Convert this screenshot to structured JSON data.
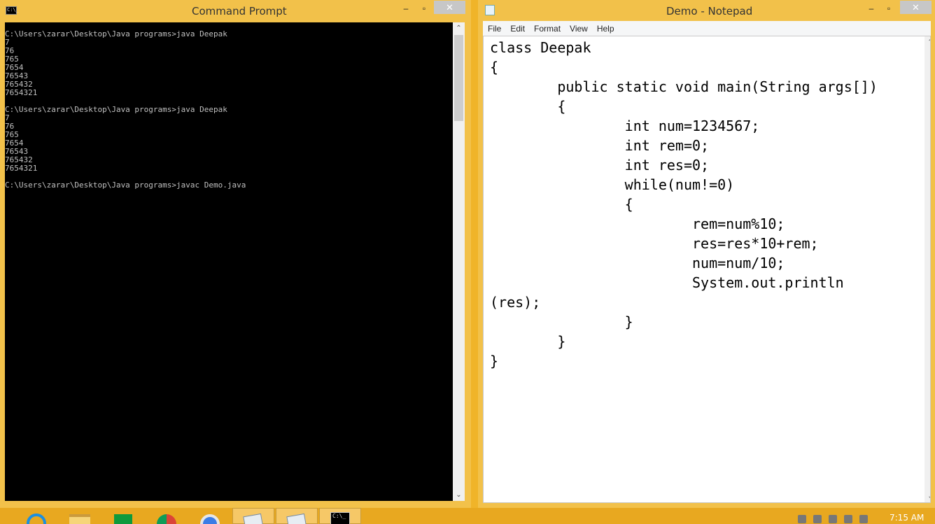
{
  "cmd": {
    "title": "Command Prompt",
    "icon_label": "C:\\_",
    "buttons": {
      "minimize": "–",
      "maximize": "▫",
      "close": "✕"
    },
    "output": "C:\\Users\\zarar\\Desktop\\Java programs>java Deepak\n7\n76\n765\n7654\n76543\n765432\n7654321\n\nC:\\Users\\zarar\\Desktop\\Java programs>java Deepak\n7\n76\n765\n7654\n76543\n765432\n7654321\n\nC:\\Users\\zarar\\Desktop\\Java programs>javac Demo.java"
  },
  "notepad": {
    "title": "Demo - Notepad",
    "buttons": {
      "minimize": "–",
      "maximize": "▫",
      "close": "✕"
    },
    "menu": [
      "File",
      "Edit",
      "Format",
      "View",
      "Help"
    ],
    "content": "class Deepak\n{\n\tpublic static void main(String args[])\n\t{\n\t\tint num=1234567;\n\t\tint rem=0;\n\t\tint res=0;\n\t\twhile(num!=0)\n\t\t{\n\t\t\trem=num%10;\n\t\t\tres=res*10+rem;\n\t\t\tnum=num/10;\n\t\t\tSystem.out.println\n(res);\n\t\t}\n\t}\n}"
  },
  "taskbar": {
    "items": [
      {
        "name": "internet-explorer-icon"
      },
      {
        "name": "file-explorer-icon"
      },
      {
        "name": "store-icon"
      },
      {
        "name": "chrome-icon"
      },
      {
        "name": "chrome-canary-icon"
      },
      {
        "name": "notepad-pinned-icon"
      },
      {
        "name": "notepad-running-icon"
      },
      {
        "name": "command-prompt-running-icon"
      }
    ],
    "cmd_icon_label": "C:\\_",
    "clock": "7:15 AM"
  },
  "colors": {
    "accent": "#f2c14a",
    "taskbar": "#e8a820",
    "console_bg": "#000000",
    "console_fg": "#c0c0c0"
  }
}
